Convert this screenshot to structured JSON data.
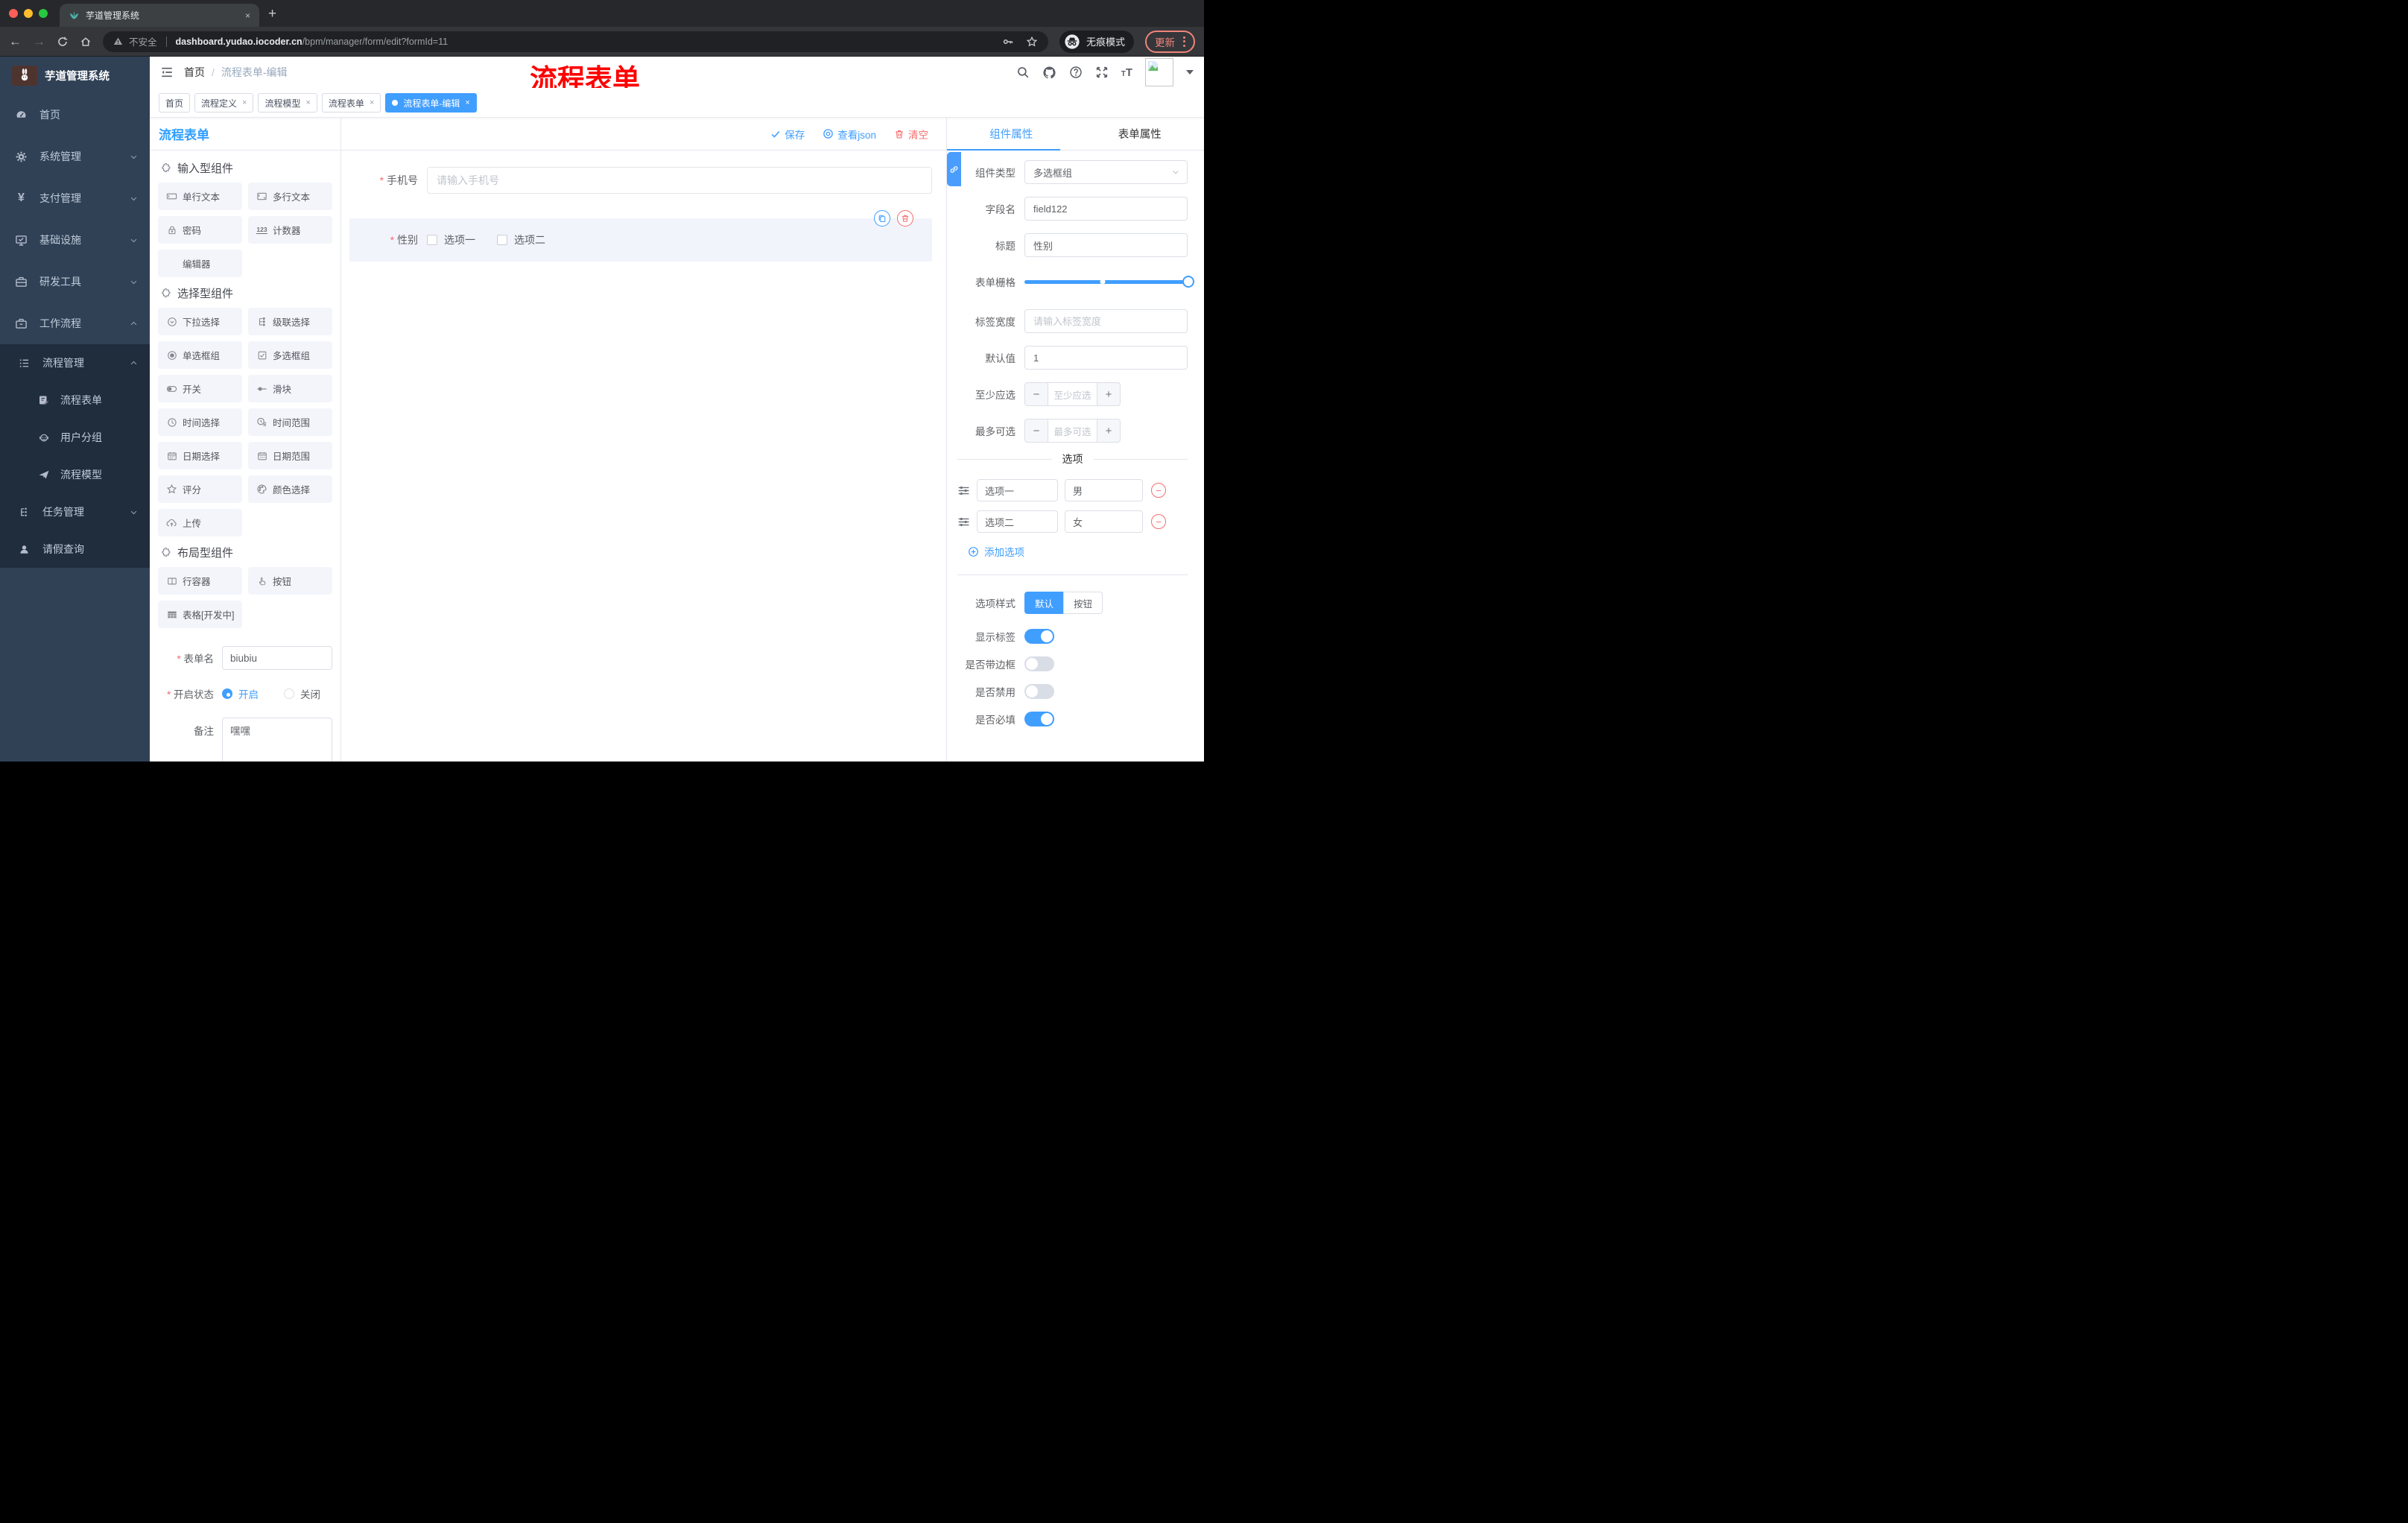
{
  "browser": {
    "tab_title": "芋道管理系统",
    "tab_close": "×",
    "new_tab": "+",
    "security_label": "不安全",
    "url_host": "dashboard.yudao.iocoder.cn",
    "url_path": "/bpm/manager/form/edit?formId=11",
    "incognito_label": "无痕模式",
    "update_label": "更新",
    "icons": [
      "plant-favicon",
      "back-icon",
      "forward-icon",
      "reload-icon",
      "home-icon",
      "warning-icon",
      "key-icon",
      "star-icon",
      "incognito-icon",
      "menu-dots-icon"
    ]
  },
  "colors": {
    "primary": "#409eff",
    "danger": "#f56c6c",
    "sidebar_bg": "#304156",
    "submenu_bg": "#1f2d3d",
    "annotation": "#ff0000",
    "active_tag": "#409eff"
  },
  "header": {
    "breadcrumb_home": "首页",
    "breadcrumb_sep": "/",
    "breadcrumb_current": "流程表单-编辑",
    "annotation": "流程表单",
    "icons": [
      "hamburger-icon",
      "search-icon",
      "github-icon",
      "help-icon",
      "fullscreen-icon",
      "font-size-icon",
      "avatar",
      "caret-down-icon"
    ]
  },
  "tags": [
    {
      "label": "首页",
      "closable": false,
      "active": false
    },
    {
      "label": "流程定义",
      "closable": true,
      "active": false,
      "close": "×"
    },
    {
      "label": "流程模型",
      "closable": true,
      "active": false,
      "close": "×"
    },
    {
      "label": "流程表单",
      "closable": true,
      "active": false,
      "close": "×"
    },
    {
      "label": "流程表单-编辑",
      "closable": true,
      "active": true,
      "close": "×"
    }
  ],
  "sidebar": {
    "brand": "芋道管理系统",
    "top_items": [
      {
        "label": "首页",
        "icon": "dashboard-icon"
      },
      {
        "label": "系统管理",
        "icon": "gear-icon",
        "arrow": "down"
      },
      {
        "label": "支付管理",
        "icon": "yen-icon",
        "arrow": "down"
      },
      {
        "label": "基础设施",
        "icon": "monitor-icon",
        "arrow": "down"
      },
      {
        "label": "研发工具",
        "icon": "toolbox-icon",
        "arrow": "down"
      },
      {
        "label": "工作流程",
        "icon": "suitcase-icon",
        "arrow": "up"
      }
    ],
    "workflow_group": {
      "manage": {
        "label": "流程管理",
        "icon": "list-icon",
        "arrow": "up"
      },
      "children": [
        {
          "label": "流程表单",
          "icon": "form-edit-icon"
        },
        {
          "label": "用户分组",
          "icon": "robot-icon"
        },
        {
          "label": "流程模型",
          "icon": "paper-plane-icon"
        }
      ],
      "task": {
        "label": "任务管理",
        "icon": "tree-icon",
        "arrow": "down"
      },
      "leave": {
        "label": "请假查询",
        "icon": "user-icon"
      }
    }
  },
  "workspace": {
    "panel_title": "流程表单",
    "actions": {
      "save": "保存",
      "view_json": "查看json",
      "clear": "清空"
    }
  },
  "palette": {
    "sections": [
      {
        "title": "输入型组件",
        "icon": "puzzle-icon",
        "items": [
          {
            "label": "单行文本",
            "icon": "input-icon"
          },
          {
            "label": "多行文本",
            "icon": "textarea-icon"
          },
          {
            "label": "密码",
            "icon": "lock-icon"
          },
          {
            "label": "计数器",
            "icon": "number-icon"
          },
          {
            "label": "编辑器",
            "icon": "none"
          }
        ]
      },
      {
        "title": "选择型组件",
        "icon": "puzzle-icon",
        "items": [
          {
            "label": "下拉选择",
            "icon": "select-icon"
          },
          {
            "label": "级联选择",
            "icon": "cascade-icon"
          },
          {
            "label": "单选框组",
            "icon": "radio-icon"
          },
          {
            "label": "多选框组",
            "icon": "checkbox-icon"
          },
          {
            "label": "开关",
            "icon": "switch-icon"
          },
          {
            "label": "滑块",
            "icon": "slider-icon"
          },
          {
            "label": "时间选择",
            "icon": "clock-icon"
          },
          {
            "label": "时间范围",
            "icon": "time-range-icon"
          },
          {
            "label": "日期选择",
            "icon": "calendar-icon"
          },
          {
            "label": "日期范围",
            "icon": "date-range-icon"
          },
          {
            "label": "评分",
            "icon": "star-icon"
          },
          {
            "label": "颜色选择",
            "icon": "palette-icon"
          },
          {
            "label": "上传",
            "icon": "upload-icon"
          }
        ]
      },
      {
        "title": "布局型组件",
        "icon": "puzzle-icon",
        "items": [
          {
            "label": "行容器",
            "icon": "row-icon"
          },
          {
            "label": "按钮",
            "icon": "hand-icon"
          },
          {
            "label": "表格[开发中]",
            "icon": "table-icon"
          }
        ]
      }
    ]
  },
  "left_form": {
    "form_name_label": "表单名",
    "form_name_value": "biubiu",
    "status_label": "开启状态",
    "status_on": "开启",
    "status_off": "关闭",
    "remark_label": "备注",
    "remark_value": "嘿嘿"
  },
  "canvas": {
    "phone": {
      "label": "手机号",
      "placeholder": "请输入手机号"
    },
    "gender": {
      "label": "性别",
      "option1": "选项一",
      "option2": "选项二",
      "icons": [
        "copy-icon",
        "trash-icon"
      ]
    }
  },
  "panel": {
    "tabs": {
      "component": "组件属性",
      "form": "表单属性"
    },
    "link_icon": "link-icon",
    "component_type": {
      "label": "组件类型",
      "value": "多选框组"
    },
    "field_name": {
      "label": "字段名",
      "value": "field122"
    },
    "title": {
      "label": "标题",
      "value": "性别"
    },
    "grid": {
      "label": "表单栅格"
    },
    "label_width": {
      "label": "标签宽度",
      "placeholder": "请输入标签宽度"
    },
    "default_value": {
      "label": "默认值",
      "value": "1"
    },
    "min_select": {
      "label": "至少应选",
      "placeholder": "至少应选",
      "minus": "−",
      "plus": "+"
    },
    "max_select": {
      "label": "最多可选",
      "placeholder": "最多可选",
      "minus": "−",
      "plus": "+"
    },
    "options_divider": "选项",
    "options": [
      {
        "label": "选项一",
        "value": "男",
        "remove": "−"
      },
      {
        "label": "选项二",
        "value": "女",
        "remove": "−"
      }
    ],
    "add_option": "添加选项",
    "option_style": {
      "label": "选项样式",
      "choice1": "默认",
      "choice2": "按钮",
      "selected": "默认"
    },
    "show_label": {
      "label": "显示标签",
      "on": true
    },
    "border": {
      "label": "是否带边框",
      "on": false
    },
    "disabled": {
      "label": "是否禁用",
      "on": false
    },
    "required": {
      "label": "是否必填",
      "on": true
    }
  }
}
